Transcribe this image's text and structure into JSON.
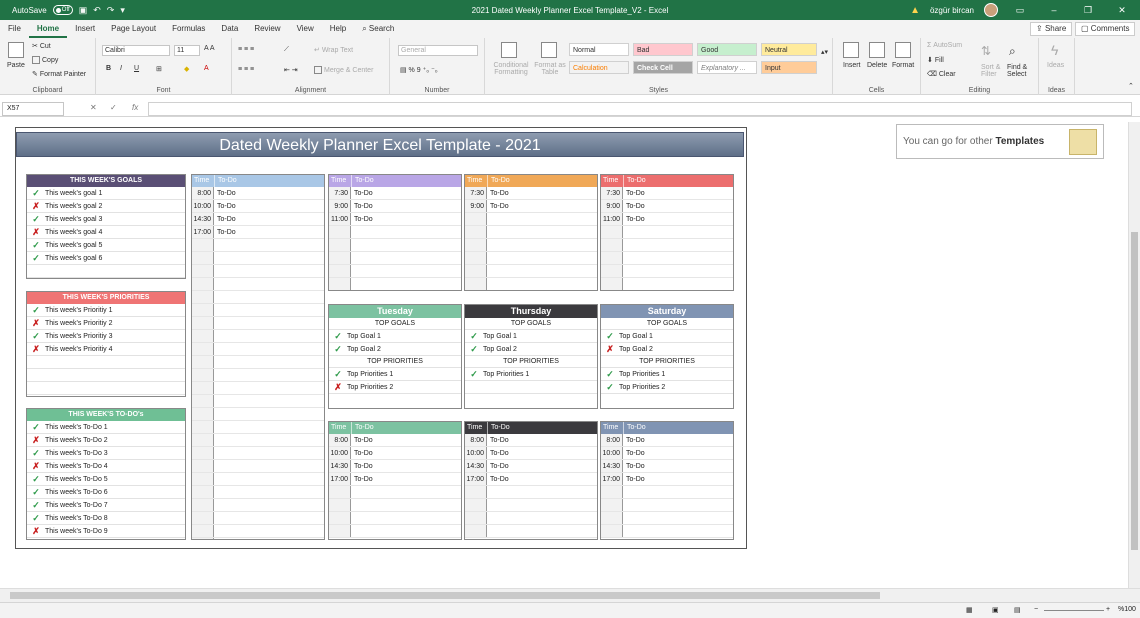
{
  "app": {
    "autosave_label": "AutoSave",
    "autosave_state": "Off",
    "window_title": "2021 Dated Weekly Planner Excel Template_V2  -  Excel",
    "user_name": "özgür bircan"
  },
  "tabs": [
    "File",
    "Home",
    "Insert",
    "Page Layout",
    "Formulas",
    "Data",
    "Review",
    "View",
    "Help"
  ],
  "search_label": "Search",
  "share_label": "Share",
  "comments_label": "Comments",
  "ribbon": {
    "clipboard": {
      "paste": "Paste",
      "cut": "Cut",
      "copy": "Copy",
      "format_painter": "Format Painter",
      "group": "Clipboard"
    },
    "font": {
      "name": "Calibri",
      "size": "11",
      "group": "Font"
    },
    "alignment": {
      "wrap": "Wrap Text",
      "merge": "Merge & Center",
      "group": "Alignment"
    },
    "number": {
      "format": "General",
      "group": "Number"
    },
    "styles": {
      "conditional": "Conditional Formatting",
      "format_table": "Format as Table",
      "normal": "Normal",
      "bad": "Bad",
      "good": "Good",
      "neutral": "Neutral",
      "calculation": "Calculation",
      "check_cell": "Check Cell",
      "explanatory": "Explanatory ...",
      "input": "Input",
      "group": "Styles"
    },
    "cells": {
      "insert": "Insert",
      "delete": "Delete",
      "format": "Format",
      "group": "Cells"
    },
    "editing": {
      "autosum": "AutoSum",
      "fill": "Fill",
      "clear": "Clear",
      "sort": "Sort & Filter",
      "find": "Find & Select",
      "group": "Editing"
    },
    "ideas": {
      "label": "Ideas",
      "group": "Ideas"
    }
  },
  "formula_bar": {
    "name_box": "X57",
    "fx": "fx"
  },
  "planner": {
    "title": "Dated Weekly Planner Excel Template - 2021",
    "promo_text": "You can go for other",
    "promo_bold": "Templates",
    "goals_header": "THIS WEEK'S GOALS",
    "goals": [
      {
        "mark": "check",
        "text": "This week's goal 1"
      },
      {
        "mark": "cross",
        "text": "This week's goal 2"
      },
      {
        "mark": "check",
        "text": "This week's goal 3"
      },
      {
        "mark": "cross",
        "text": "This week's goal 4"
      },
      {
        "mark": "check",
        "text": "This week's goal 5"
      },
      {
        "mark": "check",
        "text": "This week's goal 6"
      }
    ],
    "priorities_header": "THIS WEEK'S PRIORITIES",
    "priorities": [
      {
        "mark": "check",
        "text": "This week's Prioritiy 1"
      },
      {
        "mark": "cross",
        "text": "This week's Prioritiy 2"
      },
      {
        "mark": "check",
        "text": "This week's Prioritiy 3"
      },
      {
        "mark": "cross",
        "text": "This week's Prioritiy 4"
      }
    ],
    "todos_header": "THIS WEEK'S TO-DO's",
    "todos": [
      {
        "mark": "check",
        "text": "This week's To-Do 1"
      },
      {
        "mark": "cross",
        "text": "This week's To-Do 2"
      },
      {
        "mark": "check",
        "text": "This week's To-Do 3"
      },
      {
        "mark": "cross",
        "text": "This week's To-Do 4"
      },
      {
        "mark": "check",
        "text": "This week's To-Do 5"
      },
      {
        "mark": "check",
        "text": "This week's To-Do 6"
      },
      {
        "mark": "check",
        "text": "This week's To-Do 7"
      },
      {
        "mark": "check",
        "text": "This week's To-Do 8"
      },
      {
        "mark": "cross",
        "text": "This week's To-Do 9"
      }
    ],
    "time_label": "Time",
    "todo_label": "To-Do",
    "top_goals_label": "TOP GOALS",
    "top_priorities_label": "TOP PRIORITIES",
    "big_column": {
      "color": "#a9c7e6",
      "times": [
        "8:00",
        "10:00",
        "14:30",
        "17:00"
      ]
    },
    "top_schedules": [
      {
        "color": "#b9a6e6",
        "times": [
          "7:30",
          "9:00",
          "11:00"
        ]
      },
      {
        "color": "#f0a857",
        "times": [
          "7:30",
          "9:00"
        ]
      },
      {
        "color": "#ec6e6e",
        "times": [
          "7:30",
          "9:00",
          "11:00"
        ]
      }
    ],
    "days": [
      {
        "name": "Tuesday",
        "color": "#7cc2a1",
        "goals": [
          {
            "mark": "check",
            "text": "Top Goal 1"
          },
          {
            "mark": "check",
            "text": "Top Goal 2"
          }
        ],
        "priorities": [
          {
            "mark": "check",
            "text": "Top Priorities 1"
          },
          {
            "mark": "cross",
            "text": "Top Priorities 2"
          }
        ],
        "times": [
          "8:00",
          "10:00",
          "14:30",
          "17:00"
        ]
      },
      {
        "name": "Thursday",
        "color": "#3b3a3e",
        "goals": [
          {
            "mark": "check",
            "text": "Top Goal 1"
          },
          {
            "mark": "check",
            "text": "Top Goal 2"
          }
        ],
        "priorities": [
          {
            "mark": "check",
            "text": "Top Priorities 1"
          }
        ],
        "times": [
          "8:00",
          "10:00",
          "14:30",
          "17:00"
        ]
      },
      {
        "name": "Saturday",
        "color": "#8094b3",
        "goals": [
          {
            "mark": "check",
            "text": "Top Goal 1"
          },
          {
            "mark": "cross",
            "text": "Top Goal 2"
          }
        ],
        "priorities": [
          {
            "mark": "check",
            "text": "Top Priorities 1"
          },
          {
            "mark": "check",
            "text": "Top Priorities 2"
          }
        ],
        "times": [
          "8:00",
          "10:00",
          "14:30",
          "17:00"
        ]
      }
    ],
    "colors": {
      "goals": "#5a4f75",
      "priorities": "#ef7474",
      "todos": "#6fbf95",
      "accent": "#217346"
    }
  },
  "status": {
    "zoom": "%100"
  }
}
